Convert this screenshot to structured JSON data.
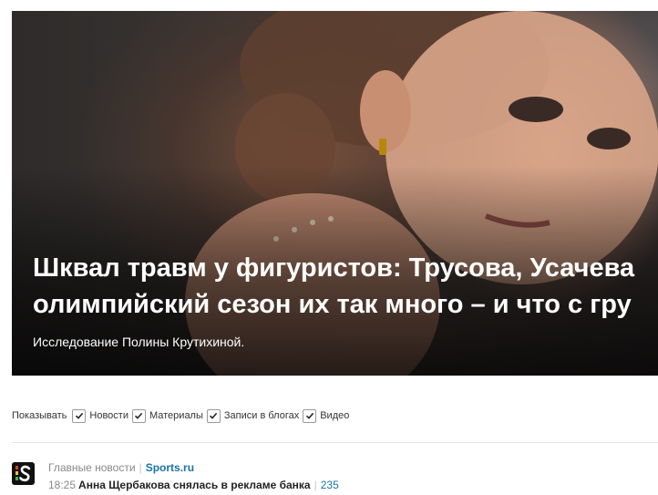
{
  "hero": {
    "headline_line1": "Шквал травм у фигуристов: Трусова, Усачева",
    "headline_line2": "олимпийский сезон их так много – и что с гру",
    "subline": "Исследование Полины Крутихиной."
  },
  "filters": {
    "label": "Показывать",
    "items": [
      {
        "label": "Новости",
        "checked": true
      },
      {
        "label": "Материалы",
        "checked": true
      },
      {
        "label": "Записи в блогах",
        "checked": true
      },
      {
        "label": "Видео",
        "checked": true
      }
    ]
  },
  "news": {
    "section_label": "Главные новости",
    "source": "Sports.ru",
    "item": {
      "time": "18:25",
      "title": "Анна Щербакова снялась в рекламе банка",
      "comments": "235"
    }
  },
  "colors": {
    "link": "#1b74a8",
    "logo_bg": "#111111"
  }
}
